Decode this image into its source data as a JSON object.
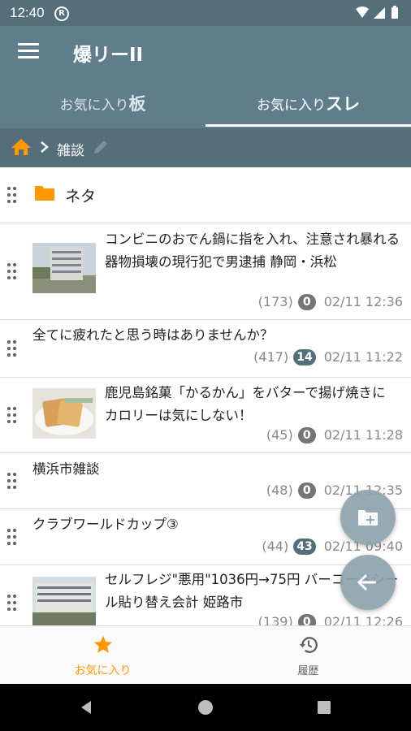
{
  "status_bar": {
    "time": "12:40"
  },
  "app_bar": {
    "title": "爆リーII",
    "menu_icon": "hamburger-menu-icon"
  },
  "tabs": [
    {
      "prefix": "お気に入り",
      "suffix": "板",
      "active": false
    },
    {
      "prefix": "お気に入り",
      "suffix": "スレ",
      "active": true
    }
  ],
  "breadcrumb": {
    "current": "雑談"
  },
  "folder": {
    "name": "ネタ"
  },
  "threads": [
    {
      "title": "コンビニのおでん鍋に指を入れ、注意され暴れる 器物損壊の現行犯で男逮捕 静岡・浜松",
      "count": "(173)",
      "unread": "0",
      "unread_style": "gray",
      "date": "02/11 12:36",
      "thumbnail": "building"
    },
    {
      "title": "全てに疲れたと思う時はありませんか？",
      "count": "(417)",
      "unread": "14",
      "unread_style": "blue",
      "date": "02/11 11:22",
      "thumbnail": "none"
    },
    {
      "title": "鹿児島銘菓「かるかん」をバターで揚げ焼きに　カロリーは気にしない！",
      "count": "(45)",
      "unread": "0",
      "unread_style": "gray",
      "date": "02/11 11:28",
      "thumbnail": "food"
    },
    {
      "title": "横浜市雑談",
      "count": "(48)",
      "unread": "0",
      "unread_style": "gray",
      "date": "02/11 12:35",
      "thumbnail": "none"
    },
    {
      "title": "クラブワールドカップ③",
      "count": "(44)",
      "unread": "43",
      "unread_style": "blue",
      "date": "02/11 09:40",
      "thumbnail": "none"
    },
    {
      "title": "セルフレジ\"悪用\"1036円→75円 バーコードシール貼り替え会計 姫路市",
      "count": "(139)",
      "unread": "0",
      "unread_style": "gray",
      "date": "02/11 12:26",
      "thumbnail": "building2"
    }
  ],
  "bottom_nav": [
    {
      "label": "お気に入り",
      "icon": "star-icon",
      "active": true
    },
    {
      "label": "履歴",
      "icon": "history-icon",
      "active": false
    }
  ],
  "colors": {
    "primary": "#607d8b",
    "primary_dark": "#546e7a",
    "accent": "#ff9800",
    "badge_blue": "#546e7a",
    "badge_gray": "#757575"
  }
}
